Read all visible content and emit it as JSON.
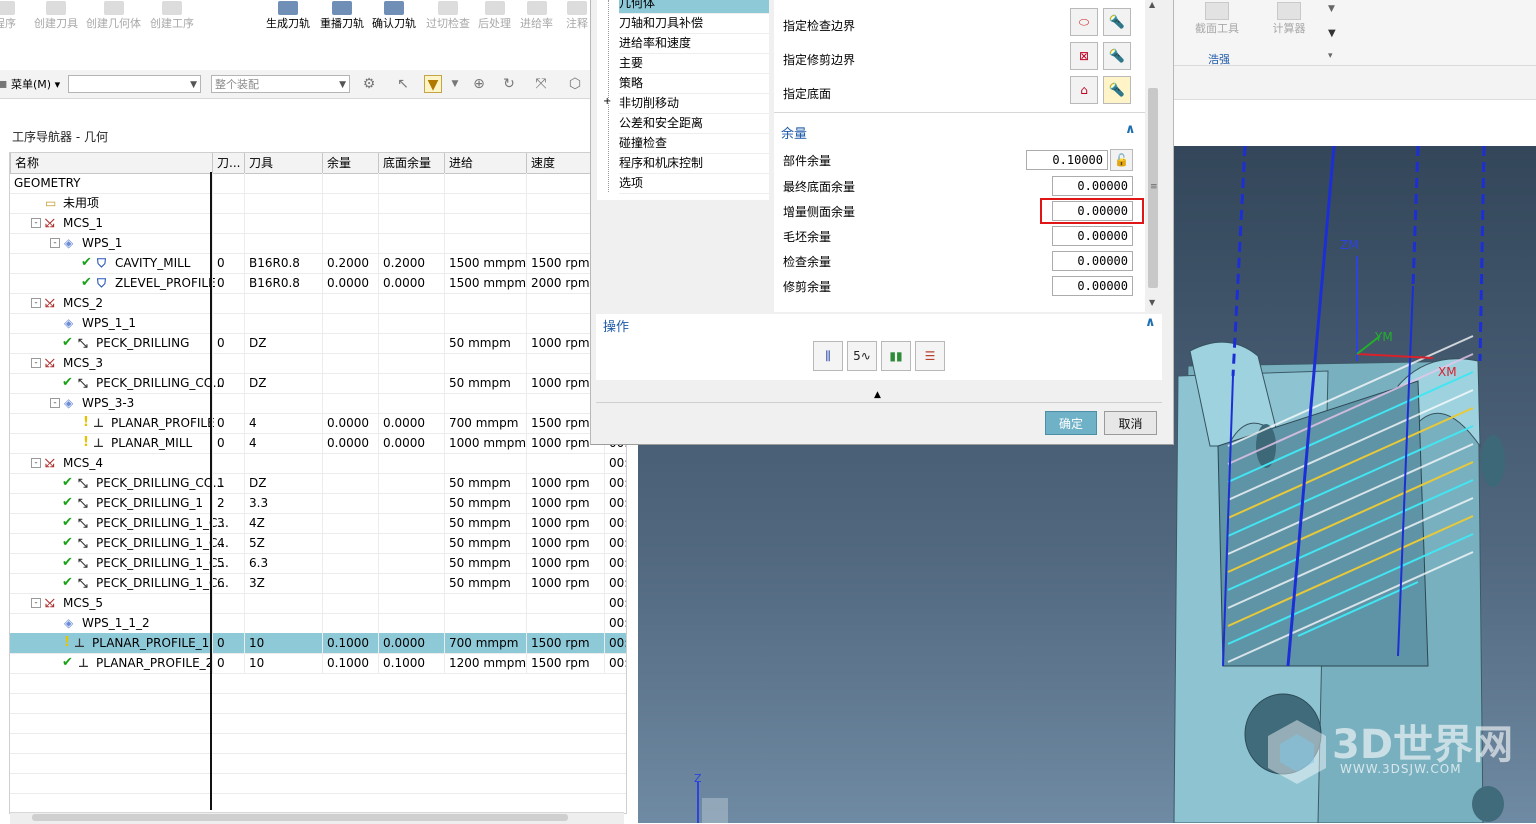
{
  "ribbon": {
    "items": [
      {
        "label": "程序",
        "state": "dim"
      },
      {
        "label": "创建刀具",
        "state": "dim"
      },
      {
        "label": "创建几何体",
        "state": "dim"
      },
      {
        "label": "创建工序",
        "state": "dim"
      },
      {
        "label": "生成刀轨",
        "state": "act"
      },
      {
        "label": "重播刀轨",
        "state": "act"
      },
      {
        "label": "确认刀轨",
        "state": "act"
      },
      {
        "label": "过切检查",
        "state": "dim"
      },
      {
        "label": "后处理",
        "state": "dim"
      },
      {
        "label": "进给率",
        "state": "dim"
      },
      {
        "label": "注释",
        "state": "dim"
      }
    ],
    "right_items": [
      "截面工具",
      "计算器"
    ],
    "right_group": "浩强"
  },
  "toolbar": {
    "menu_label": "菜单(M)",
    "filter_value": "",
    "assembly_placeholder": "整个装配"
  },
  "navigator": {
    "title": "工序导航器 - 几何",
    "columns": [
      "名称",
      "刀...",
      "刀具",
      "余量",
      "底面余量",
      "进给",
      "速度",
      ""
    ],
    "rows": [
      {
        "name": "GEOMETRY",
        "type": "root",
        "lvl": 0,
        "status": "",
        "tw": "",
        "tn": "",
        "tool": "",
        "stock": "",
        "floor": "",
        "feed": "",
        "speed": "",
        "time": ""
      },
      {
        "name": "未用项",
        "type": "folder",
        "lvl": 1,
        "status": "",
        "tw": "",
        "tn": "",
        "tool": "",
        "stock": "",
        "floor": "",
        "feed": "",
        "speed": "",
        "time": ""
      },
      {
        "name": "MCS_1",
        "type": "mcs",
        "lvl": 1,
        "status": "",
        "tw": "-",
        "tn": "",
        "tool": "",
        "stock": "",
        "floor": "",
        "feed": "",
        "speed": "",
        "time": ""
      },
      {
        "name": "WPS_1",
        "type": "wps",
        "lvl": 2,
        "status": "",
        "tw": "-",
        "tn": "",
        "tool": "",
        "stock": "",
        "floor": "",
        "feed": "",
        "speed": "",
        "time": ""
      },
      {
        "name": "CAVITY_MILL",
        "type": "mill",
        "lvl": 3,
        "status": "ok",
        "tw": "",
        "tn": "0",
        "tool": "B16R0.8",
        "stock": "0.2000",
        "floor": "0.2000",
        "feed": "1500 mmpm",
        "speed": "1500 rpm",
        "time": ""
      },
      {
        "name": "ZLEVEL_PROFILE",
        "type": "mill",
        "lvl": 3,
        "status": "ok",
        "tw": "",
        "tn": "0",
        "tool": "B16R0.8",
        "stock": "0.0000",
        "floor": "0.0000",
        "feed": "1500 mmpm",
        "speed": "2000 rpm",
        "time": ""
      },
      {
        "name": "MCS_2",
        "type": "mcs",
        "lvl": 1,
        "status": "",
        "tw": "-",
        "tn": "",
        "tool": "",
        "stock": "",
        "floor": "",
        "feed": "",
        "speed": "",
        "time": ""
      },
      {
        "name": "WPS_1_1",
        "type": "wps",
        "lvl": 2,
        "status": "",
        "tw": "",
        "tn": "",
        "tool": "",
        "stock": "",
        "floor": "",
        "feed": "",
        "speed": "",
        "time": ""
      },
      {
        "name": "PECK_DRILLING",
        "type": "drill",
        "lvl": 2,
        "status": "ok",
        "tw": "",
        "tn": "0",
        "tool": "DZ",
        "stock": "",
        "floor": "",
        "feed": "50 mmpm",
        "speed": "1000 rpm",
        "time": ""
      },
      {
        "name": "MCS_3",
        "type": "mcs",
        "lvl": 1,
        "status": "",
        "tw": "-",
        "tn": "",
        "tool": "",
        "stock": "",
        "floor": "",
        "feed": "",
        "speed": "",
        "time": ""
      },
      {
        "name": "PECK_DRILLING_CO...",
        "type": "drill",
        "lvl": 2,
        "status": "ok",
        "tw": "",
        "tn": "0",
        "tool": "DZ",
        "stock": "",
        "floor": "",
        "feed": "50 mmpm",
        "speed": "1000 rpm",
        "time": ""
      },
      {
        "name": "WPS_3-3",
        "type": "wps",
        "lvl": 2,
        "status": "",
        "tw": "-",
        "tn": "",
        "tool": "",
        "stock": "",
        "floor": "",
        "feed": "",
        "speed": "",
        "time": ""
      },
      {
        "name": "PLANAR_PROFILE",
        "type": "planar",
        "lvl": 3,
        "status": "warn",
        "tw": "",
        "tn": "0",
        "tool": "4",
        "stock": "0.0000",
        "floor": "0.0000",
        "feed": "700 mmpm",
        "speed": "1500 rpm",
        "time": ""
      },
      {
        "name": "PLANAR_MILL",
        "type": "planar",
        "lvl": 3,
        "status": "warn",
        "tw": "",
        "tn": "0",
        "tool": "4",
        "stock": "0.0000",
        "floor": "0.0000",
        "feed": "1000 mmpm",
        "speed": "1000 rpm",
        "time": "00:"
      },
      {
        "name": "MCS_4",
        "type": "mcs",
        "lvl": 1,
        "status": "",
        "tw": "-",
        "tn": "",
        "tool": "",
        "stock": "",
        "floor": "",
        "feed": "",
        "speed": "",
        "time": "00:"
      },
      {
        "name": "PECK_DRILLING_CO...",
        "type": "drill",
        "lvl": 2,
        "status": "ok",
        "tw": "",
        "tn": "1",
        "tool": "DZ",
        "stock": "",
        "floor": "",
        "feed": "50 mmpm",
        "speed": "1000 rpm",
        "time": "00:"
      },
      {
        "name": "PECK_DRILLING_1",
        "type": "drill",
        "lvl": 2,
        "status": "ok",
        "tw": "",
        "tn": "2",
        "tool": "3.3",
        "stock": "",
        "floor": "",
        "feed": "50 mmpm",
        "speed": "1000 rpm",
        "time": "00:"
      },
      {
        "name": "PECK_DRILLING_1_C...",
        "type": "drill",
        "lvl": 2,
        "status": "ok",
        "tw": "",
        "tn": "3",
        "tool": "4Z",
        "stock": "",
        "floor": "",
        "feed": "50 mmpm",
        "speed": "1000 rpm",
        "time": "00:"
      },
      {
        "name": "PECK_DRILLING_1_C...",
        "type": "drill",
        "lvl": 2,
        "status": "ok",
        "tw": "",
        "tn": "4",
        "tool": "5Z",
        "stock": "",
        "floor": "",
        "feed": "50 mmpm",
        "speed": "1000 rpm",
        "time": "00:"
      },
      {
        "name": "PECK_DRILLING_1_C...",
        "type": "drill",
        "lvl": 2,
        "status": "ok",
        "tw": "",
        "tn": "5",
        "tool": "6.3",
        "stock": "",
        "floor": "",
        "feed": "50 mmpm",
        "speed": "1000 rpm",
        "time": "00:"
      },
      {
        "name": "PECK_DRILLING_1_C...",
        "type": "drill",
        "lvl": 2,
        "status": "ok",
        "tw": "",
        "tn": "6",
        "tool": "3Z",
        "stock": "",
        "floor": "",
        "feed": "50 mmpm",
        "speed": "1000 rpm",
        "time": "00:"
      },
      {
        "name": "MCS_5",
        "type": "mcs",
        "lvl": 1,
        "status": "",
        "tw": "-",
        "tn": "",
        "tool": "",
        "stock": "",
        "floor": "",
        "feed": "",
        "speed": "",
        "time": "00:"
      },
      {
        "name": "WPS_1_1_2",
        "type": "wps",
        "lvl": 2,
        "status": "",
        "tw": "",
        "tn": "",
        "tool": "",
        "stock": "",
        "floor": "",
        "feed": "",
        "speed": "",
        "time": "00:"
      },
      {
        "name": "PLANAR_PROFILE_1",
        "type": "planar",
        "lvl": 2,
        "status": "warn",
        "tw": "",
        "tn": "0",
        "tool": "10",
        "stock": "0.1000",
        "floor": "0.0000",
        "feed": "700 mmpm",
        "speed": "1500 rpm",
        "time": "00:",
        "selected": true
      },
      {
        "name": "PLANAR_PROFILE_2",
        "type": "planar",
        "lvl": 2,
        "status": "ok",
        "tw": "",
        "tn": "0",
        "tool": "10",
        "stock": "0.1000",
        "floor": "0.1000",
        "feed": "1200 mmpm",
        "speed": "1500 rpm",
        "time": "00:"
      }
    ]
  },
  "dialog": {
    "tree": [
      {
        "label": "几何体",
        "selected": true
      },
      {
        "label": "刀轴和刀具补偿"
      },
      {
        "label": "进给率和速度"
      },
      {
        "label": "主要"
      },
      {
        "label": "策略"
      },
      {
        "label": "非切削移动",
        "expand": "+"
      },
      {
        "label": "公差和安全距离"
      },
      {
        "label": "碰撞检查"
      },
      {
        "label": "程序和机床控制"
      },
      {
        "label": "选项"
      }
    ],
    "geometry_rows": [
      {
        "label": "指定检查边界"
      },
      {
        "label": "指定修剪边界"
      },
      {
        "label": "指定底面"
      }
    ],
    "stock_section": {
      "title": "余量",
      "fields": [
        {
          "label": "部件余量",
          "value": "0.10000"
        },
        {
          "label": "最终底面余量",
          "value": "0.00000"
        },
        {
          "label": "增量侧面余量",
          "value": "0.00000"
        },
        {
          "label": "毛坯余量",
          "value": "0.00000"
        },
        {
          "label": "检查余量",
          "value": "0.00000"
        },
        {
          "label": "修剪余量",
          "value": "0.00000"
        }
      ]
    },
    "actions_title": "操作",
    "ok_label": "确定",
    "cancel_label": "取消"
  },
  "viewport": {
    "axis_labels": {
      "zm": "ZM",
      "ym": "YM",
      "xm": "XM",
      "z": "Z"
    },
    "watermark_text": "3D世界网",
    "watermark_url": "WWW.3DSJW.COM",
    "colors": {
      "background_top": "#33465a",
      "part": "#7fb4c3",
      "toolpath_blue": "#1c2fd6",
      "toolpath_cyan": "#41e6f2",
      "toolpath_yellow": "#e8c93a",
      "highlight_red": "#e01515"
    }
  }
}
